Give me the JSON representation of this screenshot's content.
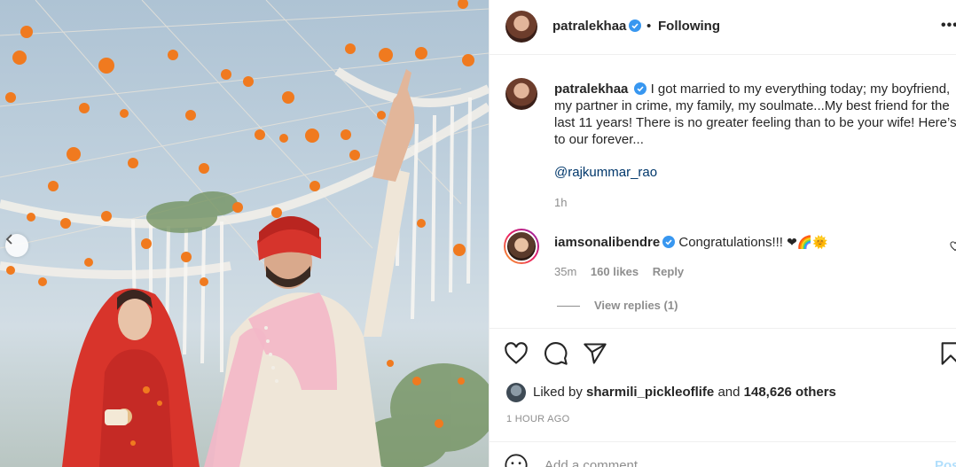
{
  "post": {
    "author": "patralekhaa",
    "follow_status": "Following",
    "dot": "•",
    "more_label": "•••"
  },
  "caption": {
    "username": "patralekhaa",
    "text": "I got married to my everything today; my boyfriend, my partner in crime, my family, my soulmate...My best friend for the last 11 years! There is no greater feeling than to be your wife! Here’s to our forever...",
    "mention": "@rajkummar_rao",
    "time": "1h"
  },
  "comment": {
    "username": "iamsonalibendre",
    "text": "Congratulations!!!",
    "emojis": "❤🌈🌞",
    "time": "35m",
    "likes": "160 likes",
    "reply_label": "Reply",
    "view_replies": "View replies (1)"
  },
  "likes": {
    "prefix": "Liked by",
    "liked_user": "sharmili_pickleoflife",
    "joiner": "and",
    "others": "148,626 others",
    "post_time": "1 HOUR AGO"
  },
  "add_comment": {
    "placeholder": "Add a comment...",
    "post_label": "Post"
  },
  "colors": {
    "verified": "#3897f0",
    "link": "#00376b",
    "muted": "#8e8e8e",
    "marigold": "#f07a1f"
  },
  "icons": [
    "chevron-left-icon",
    "verified-icon",
    "more-icon",
    "heart-icon",
    "comment-icon",
    "share-icon",
    "bookmark-icon",
    "smile-icon"
  ]
}
